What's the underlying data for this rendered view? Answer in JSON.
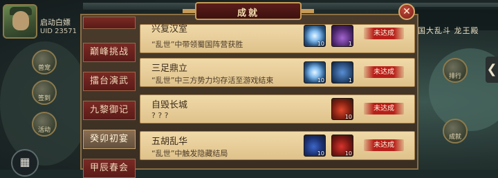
{
  "player": {
    "name": "启动白嫖",
    "uid": "UID  23571"
  },
  "right_hud": {
    "text": "国大乱斗 龙王殿"
  },
  "side_buttons": [
    "兽宠",
    "签到",
    "活动",
    "排行",
    "成就"
  ],
  "panel": {
    "title": "成就",
    "close_label": "✕"
  },
  "tabs": [
    {
      "label": "巅峰挑战",
      "active": false
    },
    {
      "label": "擂台演武",
      "active": false
    },
    {
      "label": "九黎御记",
      "active": false
    },
    {
      "label": "癸卯初宴",
      "active": true
    },
    {
      "label": "甲辰春会",
      "active": false
    }
  ],
  "achievements": [
    {
      "name": "兴复汉室",
      "desc": "“乱世”中带领蜀国阵营获胜",
      "status": "未达成",
      "rewards": [
        {
          "icon": "crystal-icon",
          "count": "10"
        },
        {
          "icon": "purple-item-icon",
          "count": "1"
        }
      ]
    },
    {
      "name": "三足鼎立",
      "desc": "“乱世”中三方势力均存活至游戏结束",
      "status": "未达成",
      "rewards": [
        {
          "icon": "crystal-icon",
          "count": "10"
        },
        {
          "icon": "book-icon",
          "count": "1"
        }
      ]
    },
    {
      "name": "自毁长城",
      "desc": "? ? ?",
      "status": "未达成",
      "rewards": [
        {
          "icon": "fruit-icon",
          "count": "10"
        }
      ]
    },
    {
      "name": "五胡乱华",
      "desc": "“乱世”中触发隐藏结局",
      "status": "未达成",
      "rewards": [
        {
          "icon": "blue-fruit-icon",
          "count": "10"
        },
        {
          "icon": "red-fruit-icon",
          "count": "10"
        }
      ]
    }
  ]
}
